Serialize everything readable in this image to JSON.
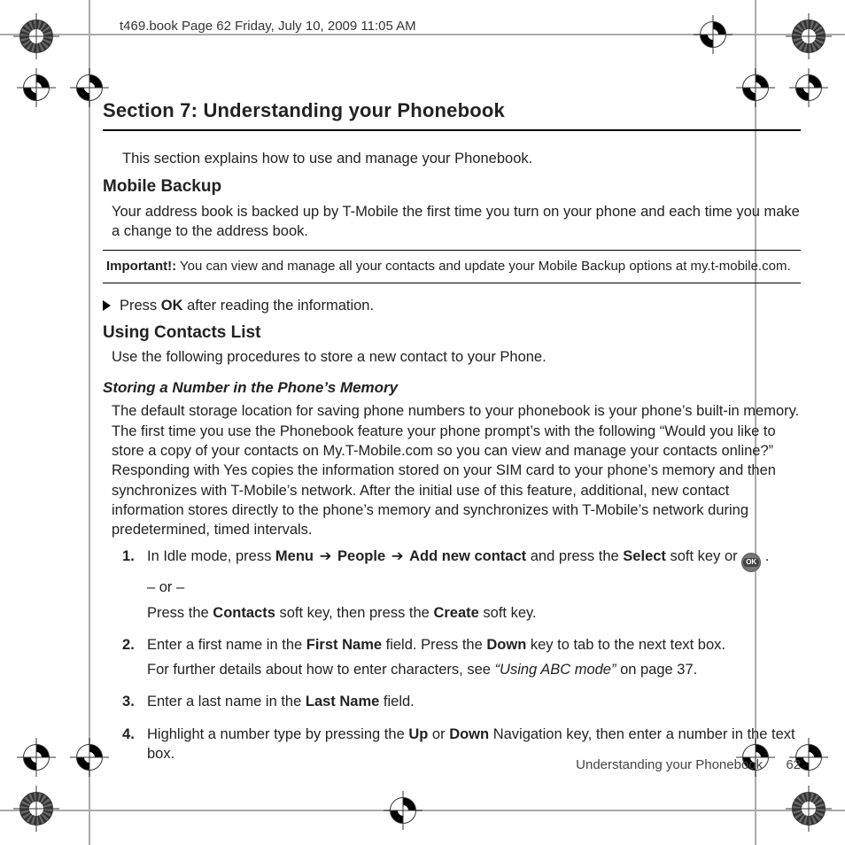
{
  "header_stamp": "t469.book  Page 62  Friday, July 10, 2009  11:05 AM",
  "section_title": "Section 7: Understanding your Phonebook",
  "intro": "This section explains how to use and manage your Phonebook.",
  "h_mobile_backup": "Mobile Backup",
  "mobile_backup_body": "Your address book is backed up by T-Mobile the first time you turn on your phone and each time you make a change to the address book.",
  "important_label": "Important!:",
  "important_body": " You can view and manage all your contacts and update your Mobile Backup options at my.t-mobile.com.",
  "press_pre": "Press ",
  "press_bold": "OK",
  "press_post": " after reading the information.",
  "h_contacts": "Using Contacts List",
  "contacts_body": "Use the following procedures to store a new contact to your Phone.",
  "h_storing": "Storing a Number in the Phone’s Memory",
  "storing_body": "The default storage location for saving phone numbers to your phonebook is your phone’s built-in memory. The first time you use the Phonebook feature your phone prompt’s with the following “Would you like to store a copy of your contacts on My.T-Mobile.com so you can view and manage your contacts online?” Responding with Yes copies the information stored on your SIM card to your phone’s memory and then synchronizes with T-Mobile’s network. After the initial use of this feature, additional, new contact information stores directly to the phone’s memory and synchronizes with T-Mobile’s network during predetermined, timed intervals.",
  "step1": {
    "a": "In Idle mode, press ",
    "menu": "Menu",
    "arrow": " ➔ ",
    "people": "People",
    "add": "Add new contact",
    "b": " and press the ",
    "select": "Select",
    "c": " soft key or ",
    "end": " .",
    "or": "– or –",
    "d": "Press the ",
    "contacts": "Contacts",
    "e": " soft key, then press the ",
    "create": "Create",
    "f": " soft key."
  },
  "step2": {
    "a": "Enter a first name in the ",
    "first": "First Name",
    "b": " field. Press the ",
    "down": "Down",
    "c": " key to tab to the next text box.",
    "d": "For further details about how to enter characters, see ",
    "ref": "“Using ABC mode”",
    "e": " on page 37."
  },
  "step3": {
    "a": "Enter a last name in the ",
    "last": "Last Name",
    "b": " field."
  },
  "step4": {
    "a": "Highlight a number type by pressing the ",
    "up": "Up",
    "b": " or ",
    "down": "Down",
    "c": " Navigation key, then enter a number in the text box."
  },
  "footer_title": "Understanding your Phonebook",
  "footer_page": "62",
  "ok_glyph": "OK"
}
